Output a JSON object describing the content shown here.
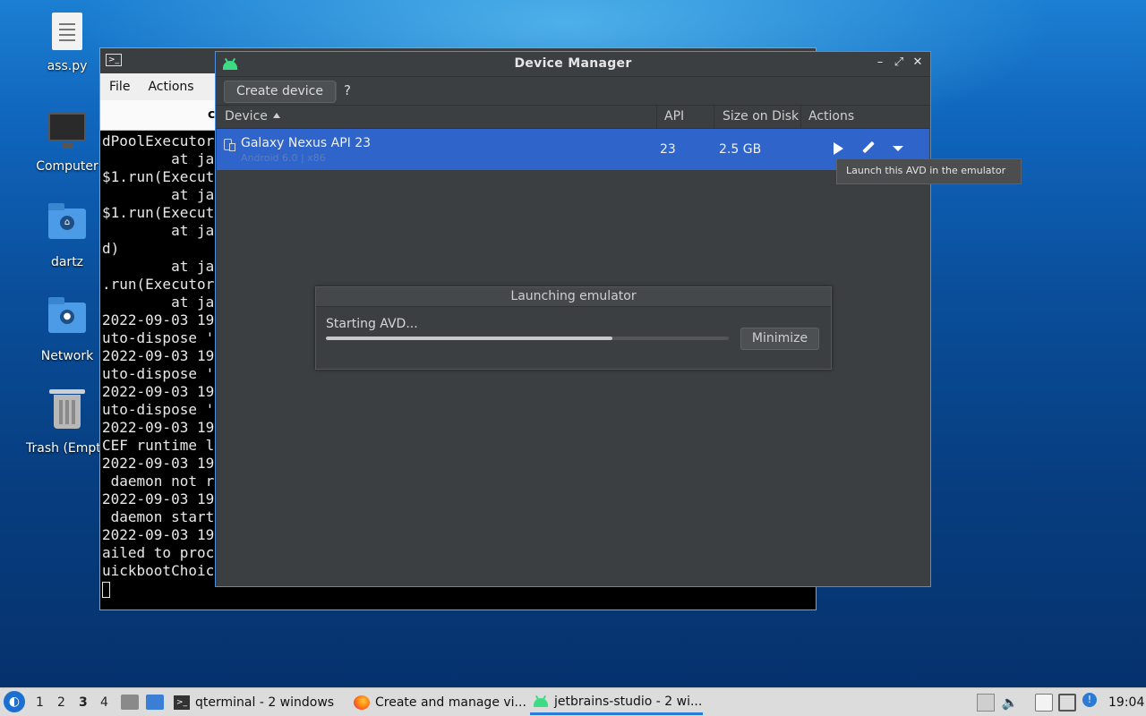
{
  "desktop": {
    "icons": [
      {
        "label": "ass.py",
        "icon": "text-file-icon"
      },
      {
        "label": "Computer",
        "icon": "monitor-icon"
      },
      {
        "label": "dartz",
        "icon": "home-folder-icon"
      },
      {
        "label": "Network",
        "icon": "network-folder-icon"
      },
      {
        "label": "Trash (Empty)",
        "icon": "trash-icon"
      }
    ]
  },
  "terminal": {
    "menu": [
      "File",
      "Actions",
      ""
    ],
    "tab_fragment": "c",
    "lines": [
      "dPoolExecutor",
      "        at ja",
      "$1.run(Execut",
      "        at ja",
      "$1.run(Execut",
      "        at ja",
      "d)",
      "        at ja",
      ".run(Executor",
      "        at ja",
      "2022-09-03 19",
      "uto-dispose '",
      "2022-09-03 19",
      "uto-dispose '",
      "2022-09-03 19",
      "uto-dispose '",
      "2022-09-03 19",
      "CEF runtime l",
      "2022-09-03 19",
      " daemon not r",
      "2022-09-03 19",
      " daemon start",
      "2022-09-03 19",
      "ailed to proc",
      "uickbootChoic"
    ]
  },
  "device_manager": {
    "title": "Device Manager",
    "toolbar": {
      "create_label": "Create device",
      "help_label": "?"
    },
    "columns": [
      "Device",
      "API",
      "Size on Disk",
      "Actions"
    ],
    "rows": [
      {
        "name": "Galaxy Nexus API 23",
        "subtitle": "Android 6.0 | x86",
        "api": "23",
        "size": "2.5 GB"
      }
    ],
    "tooltip": "Launch this AVD in the emulator",
    "launch_dialog": {
      "title": "Launching emulator",
      "status": "Starting AVD...",
      "progress": 0.71,
      "minimize_label": "Minimize"
    }
  },
  "taskbar": {
    "workspaces": [
      "1",
      "2",
      "3",
      "4"
    ],
    "active_workspace": "3",
    "tasks": [
      {
        "label": "qterminal - 2 windows",
        "icon": "terminal-icon"
      },
      {
        "label": "Create and manage vi...",
        "icon": "firefox-icon"
      },
      {
        "label": "jetbrains-studio - 2 wi...",
        "icon": "android-icon"
      }
    ],
    "clock": "19:04"
  },
  "colors": {
    "selection": "#2f65ca",
    "accent": "#4a8fe0",
    "android_green": "#3ddc84"
  }
}
